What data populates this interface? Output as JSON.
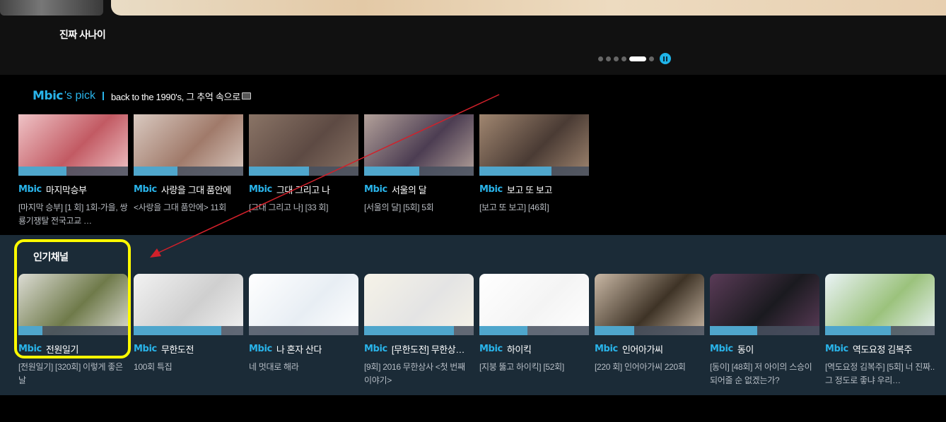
{
  "top": {
    "caption": "진짜 사나이",
    "slides": 7,
    "active_slide": 5
  },
  "pick": {
    "brand": "Mbic",
    "brand_suffix": "'s pick",
    "subtitle": "back to the 1990's, 그 추억 속으로",
    "items": [
      {
        "brand": "Mbic",
        "title": "마지막승부",
        "desc": "[마지막 승부] [1 회] 1회-가을, 쌍룡기쟁탈 전국고교 …",
        "progress": 0.44,
        "c1": "#c25a63",
        "c2": "#efc3c6"
      },
      {
        "brand": "Mbic",
        "title": "사랑을 그대 품안에",
        "desc": "<사랑을 그대 품안에> 11회",
        "progress": 0.4,
        "c1": "#a07a6a",
        "c2": "#d9c9c0"
      },
      {
        "brand": "Mbic",
        "title": "그대 그리고 나",
        "desc": "[그대 그리고 나] [33 회]",
        "progress": 0.55,
        "c1": "#5d4a43",
        "c2": "#8a7466"
      },
      {
        "brand": "Mbic",
        "title": "서울의 달",
        "desc": "[서울의 달] [5회] 5회",
        "progress": 0.5,
        "c1": "#4c3d52",
        "c2": "#b3a19a"
      },
      {
        "brand": "Mbic",
        "title": "보고 또 보고",
        "desc": "[보고 또 보고] [46회]",
        "progress": 0.66,
        "c1": "#4a3b34",
        "c2": "#a08670"
      }
    ]
  },
  "popular": {
    "heading": "인기채널",
    "items": [
      {
        "brand": "Mbic",
        "title": "전원일기",
        "desc": "[전원일기] [320회] 이렇게 좋은 날",
        "progress": 0.22,
        "c1": "#6f7a4a",
        "c2": "#dcdcd4"
      },
      {
        "brand": "Mbic",
        "title": "무한도전",
        "desc": "100회 특집",
        "progress": 0.8,
        "c1": "#cfcfcf",
        "c2": "#f2f2f2"
      },
      {
        "brand": "Mbic",
        "title": "나 혼자 산다",
        "desc": "네 멋대로 해라",
        "progress": 0.0,
        "c1": "#e8eef4",
        "c2": "#ffffff"
      },
      {
        "brand": "Mbic",
        "title": "[무한도전] 무한상…",
        "desc": "[9회] 2016 무한상사 <첫 번째 이야기>",
        "progress": 0.82,
        "c1": "#e4e4e4",
        "c2": "#f6f3e8"
      },
      {
        "brand": "Mbic",
        "title": "하이킥",
        "desc": "[지붕 뚫고 하이킥] [52회]",
        "progress": 0.44,
        "c1": "#f4f4f4",
        "c2": "#ffffff"
      },
      {
        "brand": "Mbic",
        "title": "인어아가씨",
        "desc": "[220 회] 인어아가씨 220회",
        "progress": 0.36,
        "c1": "#3e3326",
        "c2": "#c9b8a5"
      },
      {
        "brand": "Mbic",
        "title": "동이",
        "desc": "[동이] [48회] 저 아이의 스승이 되어줄 순 없겠는가?",
        "progress": 0.43,
        "c1": "#1a1a1f",
        "c2": "#5a3b57"
      },
      {
        "brand": "Mbic",
        "title": "역도요정 김복주",
        "desc": "[역도요정 김복주] [5회] 너 진짜.. 그 정도로 좋냐 우리…",
        "progress": 0.6,
        "c1": "#9bc27c",
        "c2": "#eaf3f6"
      }
    ]
  },
  "colors": {
    "accent": "#29b4ea",
    "highlight": "#fffa00",
    "arrow": "#d2202a"
  }
}
